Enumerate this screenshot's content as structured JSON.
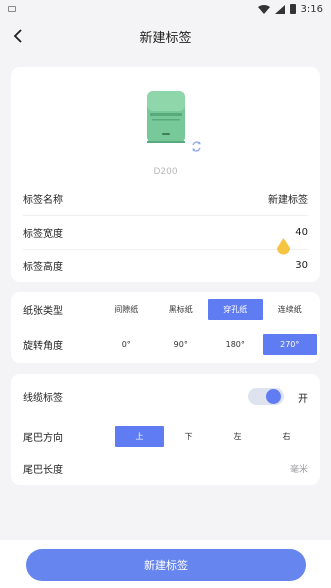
{
  "status_bar": {
    "time": "3:16"
  },
  "header": {
    "title": "新建标签"
  },
  "device": {
    "model": "D200"
  },
  "label_info": [
    {
      "label": "标签名称",
      "value": "新建标签"
    },
    {
      "label": "标签宽度",
      "value": "40"
    },
    {
      "label": "标签高度",
      "value": "30"
    }
  ],
  "paper_type": {
    "label": "纸张类型",
    "options": [
      "间隙纸",
      "黑标纸",
      "穿孔纸",
      "连续纸"
    ],
    "selected": "穿孔纸"
  },
  "rotation": {
    "label": "旋转角度",
    "options": [
      "0°",
      "90°",
      "180°",
      "270°"
    ],
    "selected": "270°"
  },
  "cable_label": {
    "label": "线缆标签",
    "toggle_text": "开",
    "enabled": true
  },
  "tail_direction": {
    "label": "尾巴方向",
    "options": [
      "上",
      "下",
      "左",
      "右"
    ],
    "selected": "上"
  },
  "tail_length": {
    "label": "尾巴长度",
    "placeholder": "毫米"
  },
  "footer": {
    "button_label": "新建标签"
  },
  "colors": {
    "accent": "#5f7cf2",
    "button": "#6785ee",
    "printer_body": "#78c99a",
    "pin": "#f5c542"
  },
  "icons": [
    "back-arrow-icon",
    "sync-icon",
    "wifi-icon",
    "signal-icon",
    "battery-icon",
    "location-pin-icon"
  ]
}
